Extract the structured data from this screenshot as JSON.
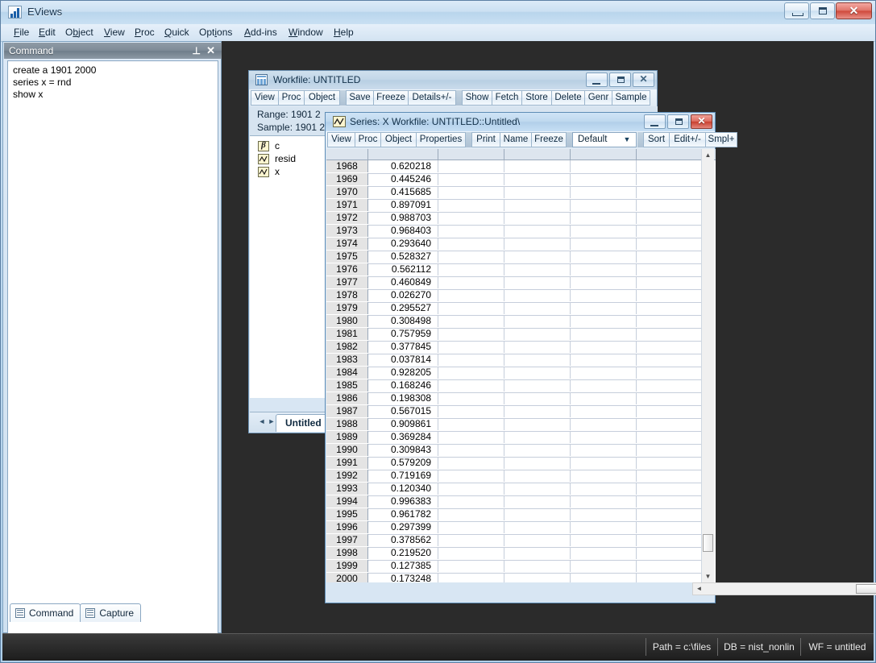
{
  "app": {
    "title": "EViews",
    "icon": "eviews-chart-icon",
    "window_buttons": {
      "minimize": "–",
      "maximize": "□",
      "close": "✕"
    }
  },
  "menubar": {
    "items": [
      {
        "label": "File",
        "accel": "F"
      },
      {
        "label": "Edit",
        "accel": "E"
      },
      {
        "label": "Object",
        "accel": "O"
      },
      {
        "label": "View",
        "accel": "V"
      },
      {
        "label": "Proc",
        "accel": "P"
      },
      {
        "label": "Quick",
        "accel": "Q"
      },
      {
        "label": "Options",
        "accel": "i"
      },
      {
        "label": "Add-ins",
        "accel": "A"
      },
      {
        "label": "Window",
        "accel": "W"
      },
      {
        "label": "Help",
        "accel": "H"
      }
    ]
  },
  "command_panel": {
    "title": "Command",
    "pin_glyph": "⊥",
    "close_glyph": "✕",
    "lines": [
      "create a 1901 2000",
      "series x = rnd",
      "show x"
    ],
    "tabs": [
      {
        "label": "Command",
        "icon": "document-icon",
        "active": true
      },
      {
        "label": "Capture",
        "icon": "document-icon",
        "active": false
      }
    ]
  },
  "workfile_window": {
    "title": "Workfile: UNTITLED",
    "icon": "workfile-grid-icon",
    "toolbar": [
      {
        "label": "View"
      },
      {
        "label": "Proc"
      },
      {
        "label": "Object"
      },
      {
        "label": "Save"
      },
      {
        "label": "Freeze"
      },
      {
        "label": "Details+/-"
      },
      {
        "label": "Show"
      },
      {
        "label": "Fetch"
      },
      {
        "label": "Store"
      },
      {
        "label": "Delete"
      },
      {
        "label": "Genr"
      },
      {
        "label": "Sample"
      }
    ],
    "range_label": "Range:  1901 2",
    "sample_label": "Sample: 1901 2",
    "objects": [
      {
        "name": "c",
        "icon": "coefficient-icon"
      },
      {
        "name": "resid",
        "icon": "series-icon"
      },
      {
        "name": "x",
        "icon": "series-icon"
      }
    ],
    "tab": "Untitled",
    "window_buttons": {
      "minimize": "–",
      "maximize": "□",
      "close": "✕"
    }
  },
  "series_window": {
    "title": "Series: X   Workfile: UNTITLED::Untitled\\",
    "icon": "series-icon",
    "toolbar": [
      {
        "label": "View"
      },
      {
        "label": "Proc"
      },
      {
        "label": "Object"
      },
      {
        "label": "Properties"
      },
      {
        "label": "Print"
      },
      {
        "label": "Name"
      },
      {
        "label": "Freeze"
      }
    ],
    "view_select": {
      "value": "Default",
      "arrow": "▼"
    },
    "toolbar_right": [
      {
        "label": "Sort"
      },
      {
        "label": "Edit+/-"
      },
      {
        "label": "Smpl+"
      }
    ],
    "window_buttons": {
      "minimize": "–",
      "maximize": "□",
      "close": "✕"
    },
    "scrollbars": {
      "vertical": {
        "up": "▲",
        "down": "▼"
      },
      "horizontal": {
        "left": "◄",
        "right": "►"
      }
    },
    "grid": {
      "rows": [
        {
          "index": "1968",
          "value": "0.620218"
        },
        {
          "index": "1969",
          "value": "0.445246"
        },
        {
          "index": "1970",
          "value": "0.415685"
        },
        {
          "index": "1971",
          "value": "0.897091"
        },
        {
          "index": "1972",
          "value": "0.988703"
        },
        {
          "index": "1973",
          "value": "0.968403"
        },
        {
          "index": "1974",
          "value": "0.293640"
        },
        {
          "index": "1975",
          "value": "0.528327"
        },
        {
          "index": "1976",
          "value": "0.562112"
        },
        {
          "index": "1977",
          "value": "0.460849"
        },
        {
          "index": "1978",
          "value": "0.026270"
        },
        {
          "index": "1979",
          "value": "0.295527"
        },
        {
          "index": "1980",
          "value": "0.308498"
        },
        {
          "index": "1981",
          "value": "0.757959"
        },
        {
          "index": "1982",
          "value": "0.377845"
        },
        {
          "index": "1983",
          "value": "0.037814"
        },
        {
          "index": "1984",
          "value": "0.928205"
        },
        {
          "index": "1985",
          "value": "0.168246"
        },
        {
          "index": "1986",
          "value": "0.198308"
        },
        {
          "index": "1987",
          "value": "0.567015"
        },
        {
          "index": "1988",
          "value": "0.909861"
        },
        {
          "index": "1989",
          "value": "0.369284"
        },
        {
          "index": "1990",
          "value": "0.309843"
        },
        {
          "index": "1991",
          "value": "0.579209"
        },
        {
          "index": "1992",
          "value": "0.719169"
        },
        {
          "index": "1993",
          "value": "0.120340"
        },
        {
          "index": "1994",
          "value": "0.996383"
        },
        {
          "index": "1995",
          "value": "0.961782"
        },
        {
          "index": "1996",
          "value": "0.297399"
        },
        {
          "index": "1997",
          "value": "0.378562"
        },
        {
          "index": "1998",
          "value": "0.219520"
        },
        {
          "index": "1999",
          "value": "0.127385"
        },
        {
          "index": "2000",
          "value": "0.173248"
        }
      ]
    }
  },
  "statusbar": {
    "path": "Path = c:\\files",
    "db": "DB = nist_nonlin",
    "wf": "WF = untitled"
  }
}
